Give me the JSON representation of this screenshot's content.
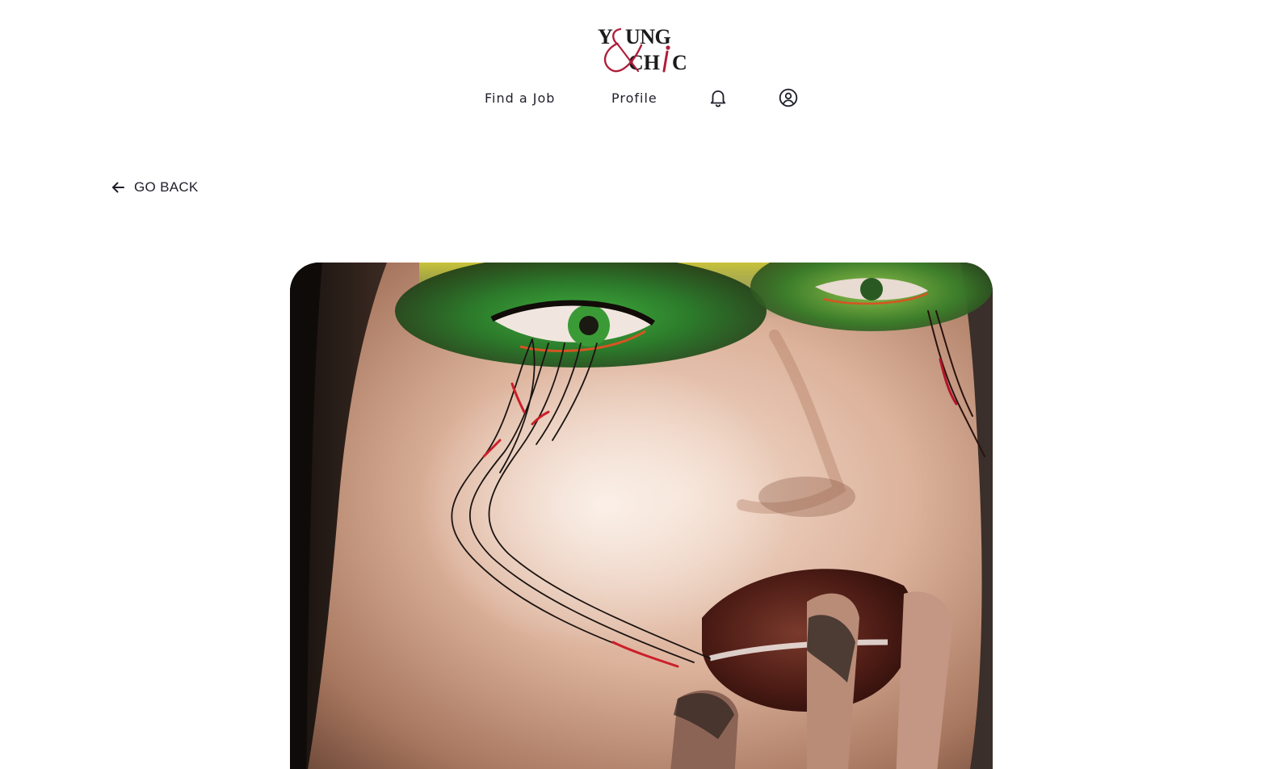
{
  "header": {
    "logo": {
      "line1": "YOUNG",
      "line2": "CHIC",
      "ampersand": "&",
      "brand_color": "#b01e3b"
    },
    "nav": {
      "find_job_label": "Find a Job",
      "profile_label": "Profile",
      "notifications_icon": "bell-icon",
      "account_icon": "user-circle-icon"
    }
  },
  "go_back": {
    "label": "GO BACK",
    "icon": "arrow-left-icon"
  },
  "hero": {
    "image": "portrait-photo"
  },
  "colors": {
    "text": "#1f1f2b",
    "background": "#ffffff",
    "brand": "#b01e3b"
  }
}
